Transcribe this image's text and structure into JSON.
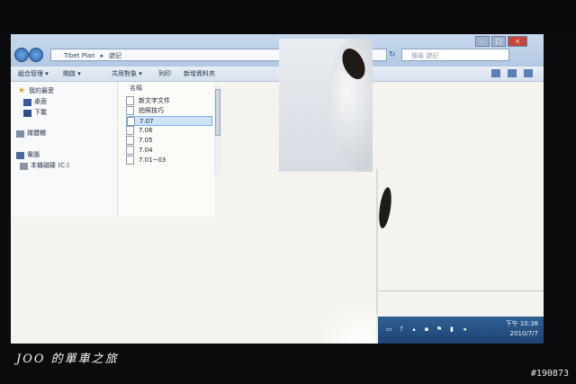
{
  "explorer": {
    "address": {
      "segments": [
        "Tibet Plan",
        "▸",
        "遊記"
      ]
    },
    "search_placeholder": "搜尋 遊記",
    "toolbar": {
      "organize": "組合管理 ▾",
      "open": "開啟 ▾",
      "share": "共用對象 ▾",
      "print": "列印",
      "new_folder": "新增資料夾"
    },
    "nav": {
      "favorites": "我的最愛",
      "desktop": "桌面",
      "downloads": "下載",
      "libraries": "媒體櫃",
      "computer": "電腦",
      "local_disk": "本機磁碟 (C:)"
    },
    "column_header": "名稱",
    "files": [
      {
        "name": "新文字文件"
      },
      {
        "name": "拍照技巧"
      },
      {
        "name": "7.07",
        "selected": true
      },
      {
        "name": "7.06"
      },
      {
        "name": "7.05"
      },
      {
        "name": "7.04"
      },
      {
        "name": "7.01~03"
      }
    ]
  },
  "taskbar": {
    "time": "下午 10:38",
    "date": "2010/7/7",
    "tray_icons": [
      "keyboard-icon",
      "help-icon",
      "chevron-up-icon",
      "network-icon",
      "flag-icon",
      "battery-icon",
      "volume-icon"
    ]
  },
  "overlay": {
    "watermark": "JOO 的單車之旅",
    "photo_id": "#190873"
  }
}
